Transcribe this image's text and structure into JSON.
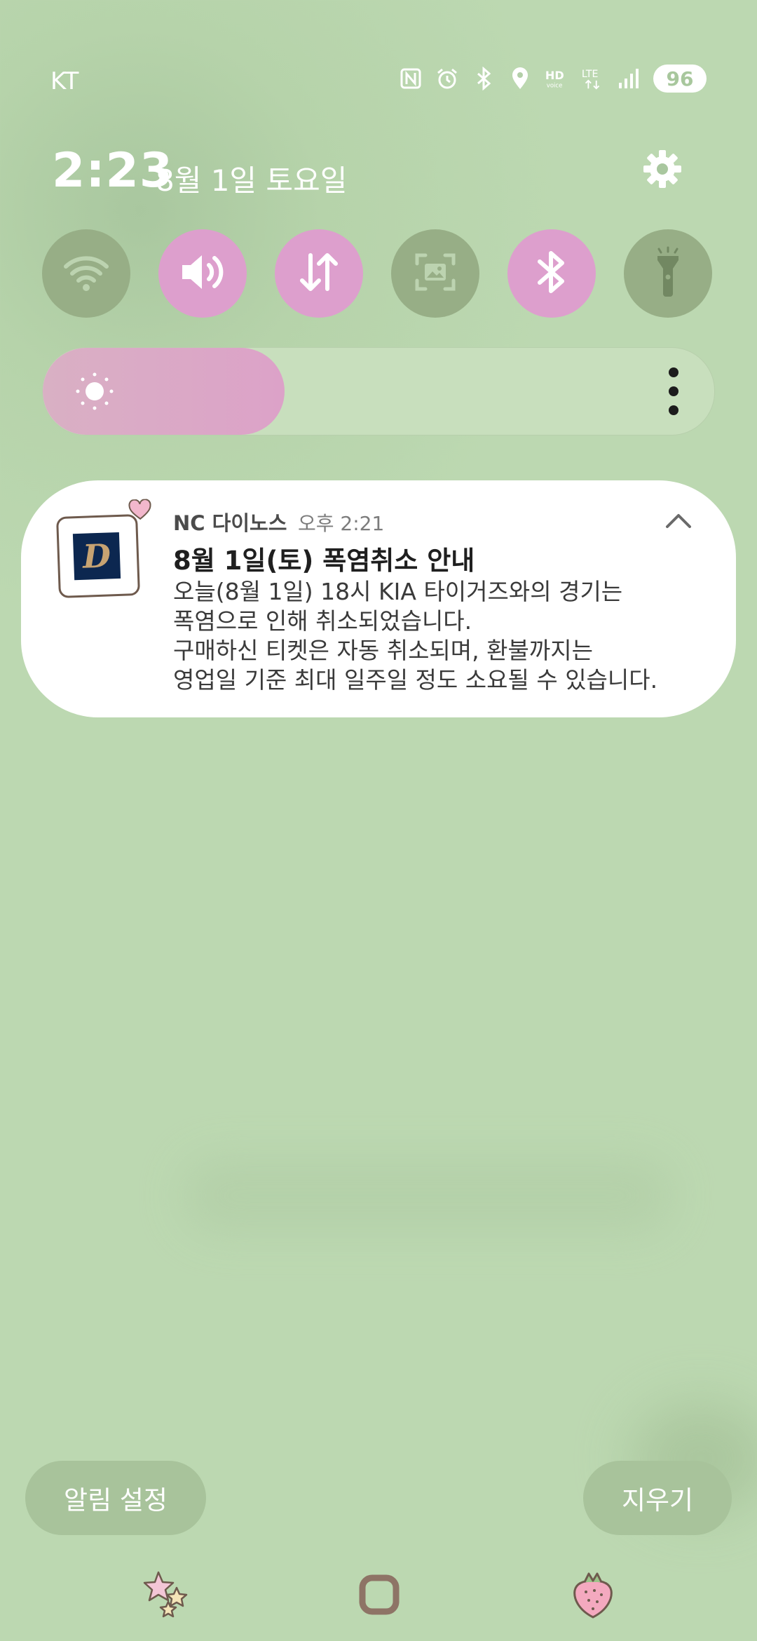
{
  "status_bar": {
    "carrier": "KT",
    "icons": [
      "nfc-icon",
      "alarm-icon",
      "bluetooth-icon",
      "location-icon",
      "hd-voice-icon",
      "lte-icon",
      "signal-icon"
    ],
    "battery": "96"
  },
  "header": {
    "time": "2:23",
    "date": "8월 1일 토요일"
  },
  "quick_tiles": [
    {
      "name": "wifi",
      "state": "off"
    },
    {
      "name": "sound",
      "state": "on"
    },
    {
      "name": "mobile-data",
      "state": "on"
    },
    {
      "name": "screen-capture",
      "state": "off"
    },
    {
      "name": "bluetooth",
      "state": "on"
    },
    {
      "name": "flashlight",
      "state": "off"
    }
  ],
  "brightness": {
    "level": 0.36
  },
  "notification": {
    "app": "NC 다이노스",
    "time": "오후 2:21",
    "title": "8월 1일(토) 폭염취소 안내",
    "body_lines": [
      "오늘(8월 1일) 18시 KIA 타이거즈와의 경기는",
      "폭염으로 인해 취소되었습니다.",
      "구매하신 티켓은 자동 취소되며, 환불까지는",
      "영업일 기준 최대 일주일 정도 소요될 수 있습니다."
    ]
  },
  "buttons": {
    "notification_settings": "알림 설정",
    "clear": "지우기"
  },
  "colors": {
    "background": "#bcd8b1",
    "tile_on": "#dd9fcd",
    "tile_off": "#97ae86",
    "pill": "#a8c39b"
  }
}
